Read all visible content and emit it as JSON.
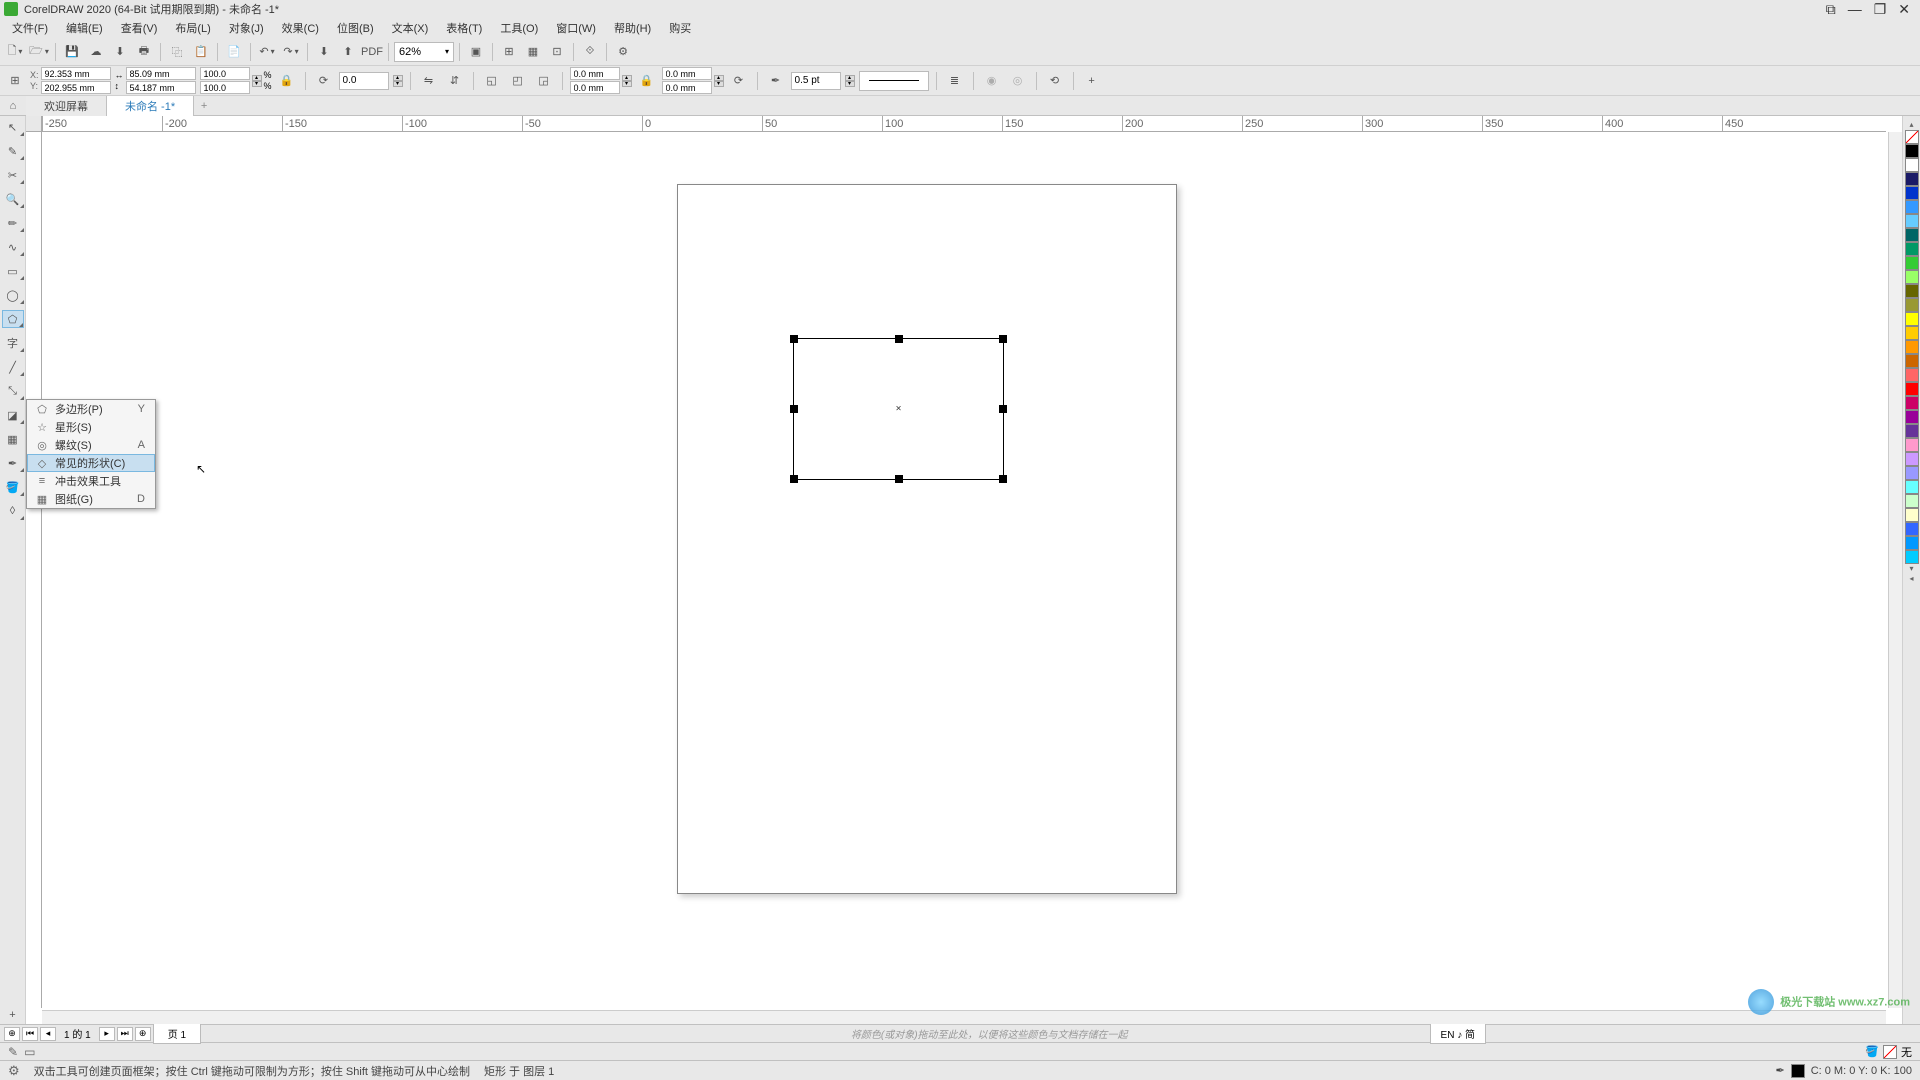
{
  "title": "CorelDRAW 2020 (64-Bit 试用期限到期) - 未命名 -1*",
  "menus": [
    "文件(F)",
    "编辑(E)",
    "查看(V)",
    "布局(L)",
    "对象(J)",
    "效果(C)",
    "位图(B)",
    "文本(X)",
    "表格(T)",
    "工具(O)",
    "窗口(W)",
    "帮助(H)",
    "购买"
  ],
  "toolbar": {
    "zoom": "62%"
  },
  "property_bar": {
    "x_label": "X:",
    "y_label": "Y:",
    "x": "92.353 mm",
    "y": "202.955 mm",
    "w": "85.09 mm",
    "h": "54.187 mm",
    "scale_x": "100.0",
    "scale_y": "100.0",
    "pct": "%",
    "rotation": "0.0",
    "corner1": "0.0 mm",
    "corner2": "0.0 mm",
    "corner3": "0.0 mm",
    "corner4": "0.0 mm",
    "outline_width": "0.5 pt"
  },
  "doc_tabs": {
    "welcome": "欢迎屏幕",
    "doc1": "未命名 -1*",
    "add": "+"
  },
  "ruler_ticks": [
    "-250",
    "-200",
    "-150",
    "-100",
    "-50",
    "0",
    "50",
    "100",
    "150",
    "200",
    "250",
    "300",
    "350",
    "400",
    "450"
  ],
  "flyout": {
    "items": [
      {
        "icon": "⬠",
        "label": "多边形(P)",
        "shortcut": "Y"
      },
      {
        "icon": "☆",
        "label": "星形(S)",
        "shortcut": ""
      },
      {
        "icon": "◎",
        "label": "螺纹(S)",
        "shortcut": "A"
      },
      {
        "icon": "◇",
        "label": "常见的形状(C)",
        "shortcut": ""
      },
      {
        "icon": "≡",
        "label": "冲击效果工具",
        "shortcut": ""
      },
      {
        "icon": "▦",
        "label": "图纸(G)",
        "shortcut": "D"
      }
    ],
    "highlighted_index": 3
  },
  "page_nav": {
    "counter": "1 的 1",
    "page_label": "页 1",
    "hint": "将颜色(或对象)拖动至此处，以便将这些颜色与文档存储在一起",
    "ime": "EN ♪ 简"
  },
  "color_status": {
    "fill_label": "无"
  },
  "status": {
    "hint": "双击工具可创建页面框架；按住 Ctrl 键拖动可限制为方形；按住 Shift 键拖动可从中心绘制",
    "selection": "矩形 于 图层 1",
    "cmyk": "C: 0 M: 0 Y: 0 K: 100"
  },
  "colors": [
    "#000000",
    "#ffffff",
    "#1a1a66",
    "#0033cc",
    "#3399ff",
    "#66ccff",
    "#006666",
    "#009966",
    "#33cc33",
    "#99ff66",
    "#666600",
    "#999933",
    "#ffff00",
    "#ffcc00",
    "#ff9900",
    "#cc6600",
    "#ff6666",
    "#ff0000",
    "#cc0066",
    "#990099",
    "#663399",
    "#ff99cc",
    "#cc99ff",
    "#9999ff",
    "#66ffff",
    "#ccffcc",
    "#ffffcc",
    "#3366ff",
    "#0099ff",
    "#00ccff"
  ],
  "watermark": "极光下载站 www.xz7.com"
}
